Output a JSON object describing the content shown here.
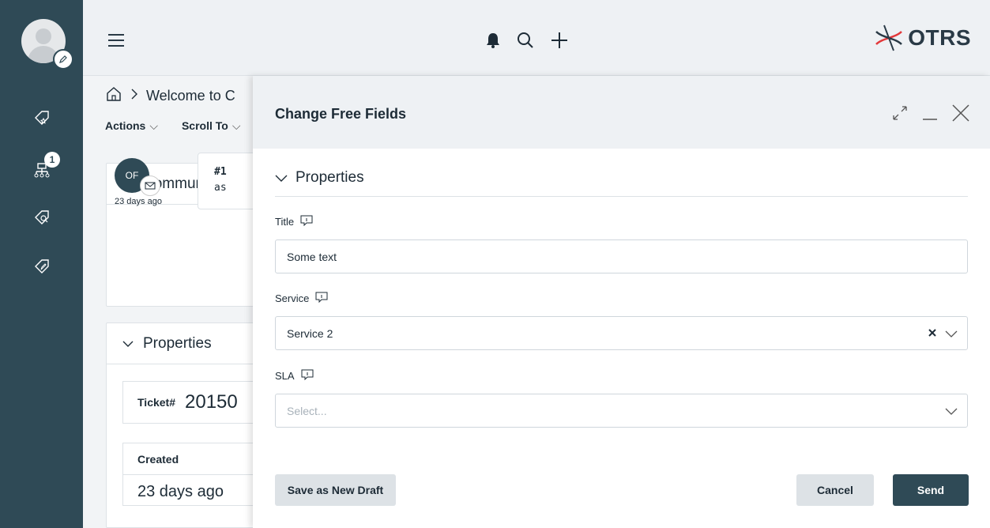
{
  "header": {
    "logo_text": "OTRS",
    "icons": [
      "hamburger-icon",
      "bell-icon",
      "search-icon",
      "plus-icon"
    ]
  },
  "sidebar": {
    "notification_count": "1",
    "icons": [
      "avatar",
      "star-tag-icon",
      "hierarchy-icon",
      "search-tag-icon",
      "edit-tag-icon"
    ]
  },
  "background": {
    "breadcrumb": "Welcome to C",
    "actions": [
      "Actions",
      "Scroll To"
    ],
    "communication_title": "Communicatio",
    "sender_initials": "OF",
    "sender_time": "23 days ago",
    "bubble_line1": "#1",
    "bubble_line2": "as",
    "properties_title": "Properties",
    "ticket_label": "Ticket#",
    "ticket_value": "20150",
    "created_label": "Created",
    "created_value": "23 days ago"
  },
  "modal": {
    "title": "Change Free Fields",
    "section": "Properties",
    "fields": {
      "title_label": "Title",
      "title_value": "Some text",
      "service_label": "Service",
      "service_value": "Service 2",
      "sla_label": "SLA",
      "sla_placeholder": "Select..."
    },
    "buttons": {
      "draft": "Save as New Draft",
      "cancel": "Cancel",
      "send": "Send"
    }
  },
  "colors": {
    "sidebar": "#2f4a56",
    "header_bg": "#eef1f4",
    "primary_button": "#2f4a56"
  }
}
